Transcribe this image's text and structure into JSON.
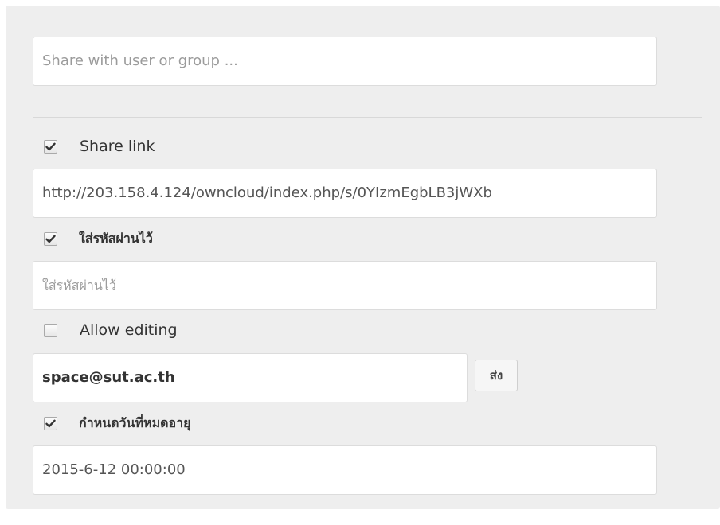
{
  "share_with": {
    "placeholder": "Share with user or group ..."
  },
  "share_link": {
    "checked": true,
    "label": "Share link",
    "url": "http://203.158.4.124/owncloud/index.php/s/0YIzmEgbLB3jWXb"
  },
  "password": {
    "checked": true,
    "label": "ใส่รหัสผ่านไว้",
    "placeholder": "ใส่รหัสผ่านไว้"
  },
  "allow_editing": {
    "checked": false,
    "label": "Allow editing"
  },
  "email": {
    "value": "space@sut.ac.th",
    "send_label": "ส่ง"
  },
  "expiration": {
    "checked": true,
    "label": "กำหนดวันที่หมดอายุ",
    "value": "2015-6-12 00:00:00"
  }
}
